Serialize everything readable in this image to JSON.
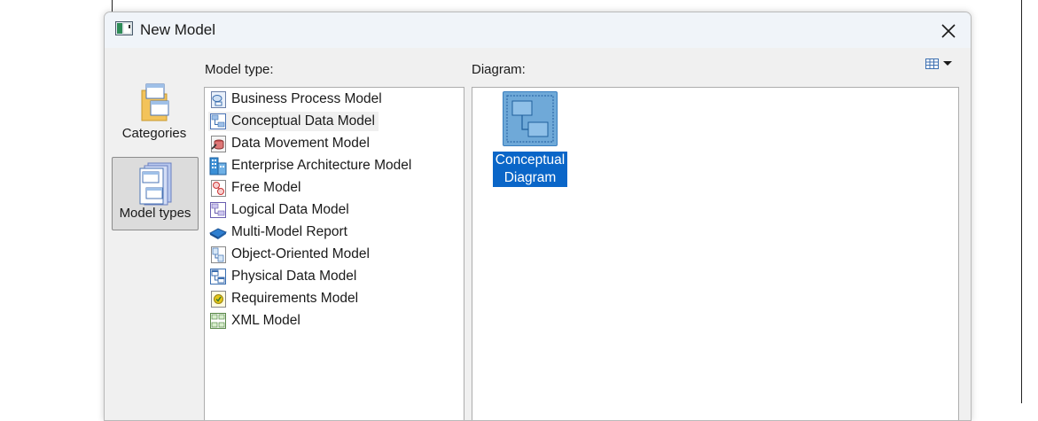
{
  "window": {
    "title": "New Model",
    "close_icon": "close-icon"
  },
  "labels": {
    "model_type": "Model type:",
    "diagram": "Diagram:"
  },
  "categories": [
    {
      "label": "Categories",
      "icon": "folder-icon",
      "active": false
    },
    {
      "label": "Model types",
      "icon": "model-types-icon",
      "active": true
    }
  ],
  "model_types": [
    {
      "label": "Business Process Model",
      "icon": "business-process-icon"
    },
    {
      "label": "Conceptual Data Model",
      "icon": "conceptual-data-icon",
      "selected": true
    },
    {
      "label": "Data Movement Model",
      "icon": "data-movement-icon"
    },
    {
      "label": "Enterprise Architecture Model",
      "icon": "enterprise-architecture-icon"
    },
    {
      "label": "Free Model",
      "icon": "free-model-icon"
    },
    {
      "label": "Logical Data Model",
      "icon": "logical-data-icon"
    },
    {
      "label": "Multi-Model Report",
      "icon": "multi-model-report-icon"
    },
    {
      "label": "Object-Oriented Model",
      "icon": "object-oriented-icon"
    },
    {
      "label": "Physical Data Model",
      "icon": "physical-data-icon"
    },
    {
      "label": "Requirements Model",
      "icon": "requirements-icon"
    },
    {
      "label": "XML Model",
      "icon": "xml-model-icon"
    }
  ],
  "diagrams": [
    {
      "label": "Conceptual\nDiagram",
      "icon": "conceptual-diagram-icon",
      "selected": true
    }
  ],
  "colors": {
    "selection": "#0a66c8",
    "dialog_bg": "#f0f0f0",
    "titlebar_bg": "#f0f4f9"
  }
}
